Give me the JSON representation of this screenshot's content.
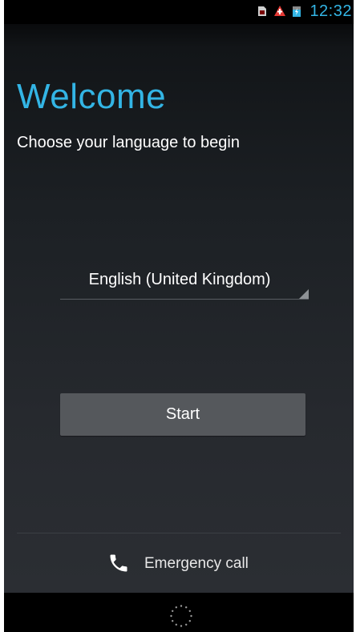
{
  "status_bar": {
    "time": "12:32",
    "icons": [
      "sim-card-icon",
      "alert-icon",
      "battery-icon"
    ],
    "accent_color": "#33b5e5"
  },
  "welcome": {
    "title": "Welcome",
    "subtitle": "Choose your language to begin"
  },
  "language": {
    "selected": "English (United Kingdom)"
  },
  "start_button": {
    "label": "Start"
  },
  "emergency": {
    "label": "Emergency call",
    "icon": "phone-icon"
  },
  "nav_bar": {
    "icon": "loading-spinner-icon"
  }
}
